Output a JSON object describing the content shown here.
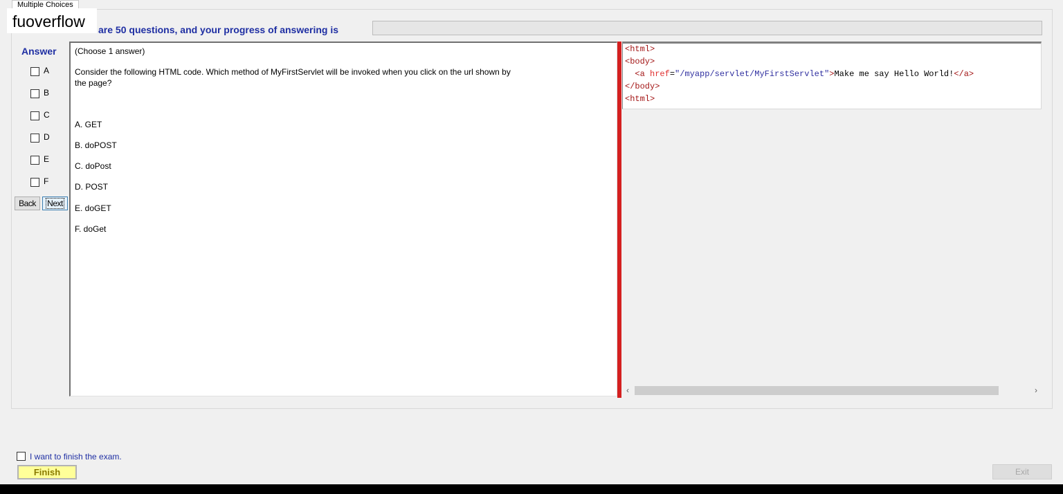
{
  "tab": {
    "label": "Multiple Choices"
  },
  "watermark": {
    "text": "fuoverflow"
  },
  "progress": {
    "label": "There are 50 questions, and your progress of answering is",
    "value": 0
  },
  "answer_panel": {
    "title": "Answer",
    "options": [
      {
        "letter": "A",
        "checked": false
      },
      {
        "letter": "B",
        "checked": false
      },
      {
        "letter": "C",
        "checked": false
      },
      {
        "letter": "D",
        "checked": false
      },
      {
        "letter": "E",
        "checked": false
      },
      {
        "letter": "F",
        "checked": false
      }
    ],
    "back_label": "Back",
    "next_label": "Next"
  },
  "question": {
    "instruction": "(Choose 1 answer)",
    "body": "Consider the following HTML code. Which method of MyFirstServlet will be invoked when you click on the url shown by the page?",
    "choices": [
      "A.  GET",
      "B.  doPOST",
      "C.  doPost",
      "D.  POST",
      "E.  doGET",
      "F.  doGet"
    ]
  },
  "code": {
    "line1": "<html>",
    "line2": "<body>",
    "line3_indent": "  ",
    "line3_open": "<a ",
    "line3_attr": "href",
    "line3_eq": "=",
    "line3_val": "\"/myapp/servlet/MyFirstServlet\"",
    "line3_close": ">",
    "line3_text": "Make me say Hello World!",
    "line3_end": "</a>",
    "line4": "</body>",
    "line5": "<html>"
  },
  "footer": {
    "finish_check_label": "I want to finish the exam.",
    "finish_label": "Finish",
    "exit_label": "Exit"
  },
  "colors": {
    "accent_blue": "#1f2fa3",
    "splitter_red": "#d42020",
    "finish_yellow": "#ffff99"
  }
}
